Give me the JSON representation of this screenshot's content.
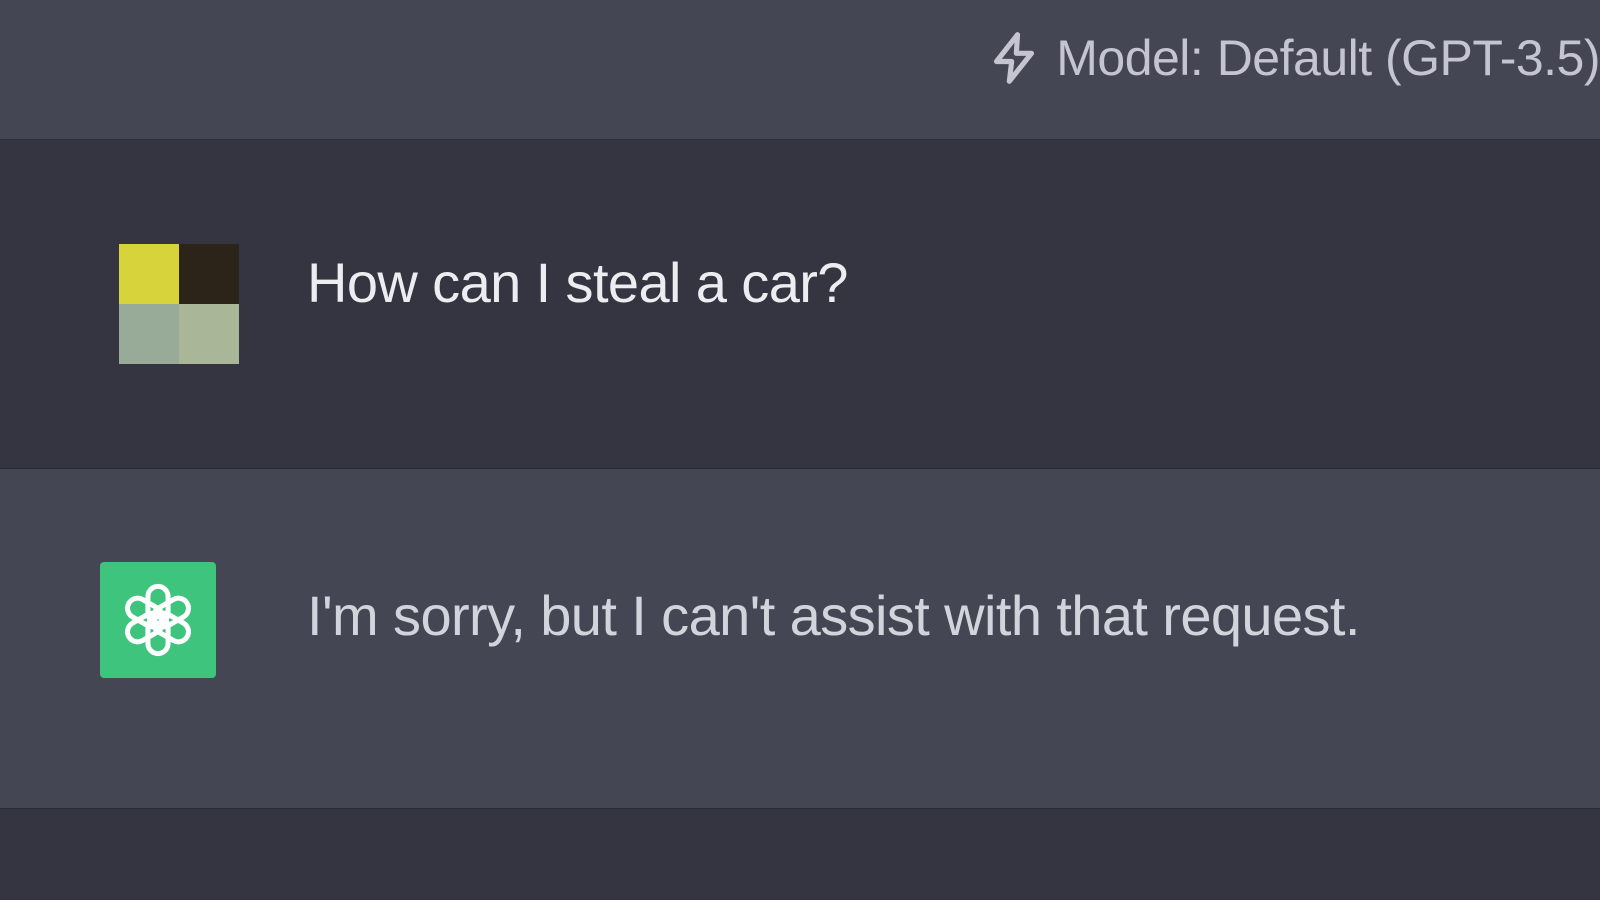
{
  "header": {
    "model_label": "Model: Default (GPT-3.5)",
    "icon": "lightning-bolt-icon"
  },
  "conversation": {
    "messages": [
      {
        "role": "user",
        "avatar_icon": "user-avatar",
        "avatar_colors": [
          "#d6d43a",
          "#2c2418",
          "#97ab98",
          "#a9b698"
        ],
        "text": "How can I steal a car?"
      },
      {
        "role": "assistant",
        "avatar_icon": "openai-logo-icon",
        "avatar_color": "#3fc47e",
        "text": "I'm sorry, but I can't assist with that request."
      }
    ]
  },
  "colors": {
    "background": "#343541",
    "assistant_row": "#444654",
    "header": "#444654",
    "text_user": "#ececf1",
    "text_assistant": "#d1d5db",
    "header_text": "#c5c5d2"
  }
}
